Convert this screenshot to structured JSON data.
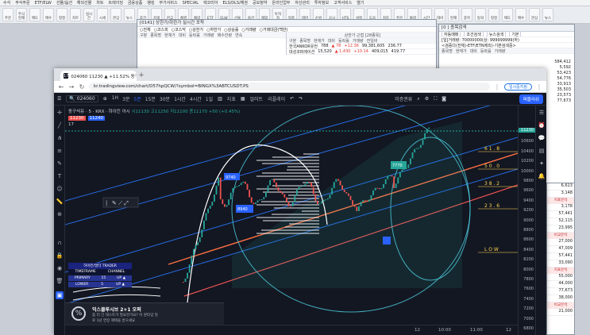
{
  "hts": {
    "menu": [
      "수식",
      "주식주문",
      "ETF/ELW",
      "선물/옵션",
      "해외선물",
      "차트",
      "트레이딩",
      "금융상품",
      "뱅킹",
      "부가서비스",
      "SPECIAL",
      "렉코리아",
      "ELS/DLS/채권",
      "공모청약",
      "온라인업무",
      "자산관리",
      "투자정보",
      "고객서비스",
      "열기"
    ],
    "toolbar": [
      "주문",
      "주식현재",
      "매도",
      "매수",
      "정정",
      "차트",
      "실시간",
      "시세",
      "관심",
      "뉴스",
      "조건",
      "검색",
      "잔고",
      "체결",
      "예약",
      "ETF",
      "ELW",
      "선물",
      "옵션",
      "해외",
      "투자자",
      "업종",
      "테마",
      "순위",
      "공시",
      "HTS",
      "설정",
      "도움",
      "차트",
      "주문",
      "통합",
      "시간",
      "대비",
      "현재",
      "종목",
      "등락",
      "정정",
      "매도",
      "매수",
      "관심",
      "뉴스"
    ],
    "mid_window": {
      "title": "[0141] 상한가/하한가 실시간 포착",
      "radios": [
        "전체",
        "코스피",
        "코스닥",
        "상한가",
        "하한가",
        "상승률",
        "거래량",
        "거래대금(백만)"
      ],
      "cols_left": [
        "구분",
        "종목명",
        "현재가",
        "대비",
        "등락률",
        "거래량",
        "매수잔량",
        "연속"
      ],
      "right_title": "상한가 근접 [28종목]",
      "cols_right": [
        "구분",
        "종목명",
        "현재가",
        "대비",
        "등락률",
        "거래량",
        "전일비"
      ],
      "rows": [
        {
          "name": "한국ANKOR유전",
          "price": "788",
          "diff": "▲ 78",
          "rate": "+12.36",
          "vol": "99,381,605",
          "prev": "236.77"
        },
        {
          "name": "대성코퍼레이션",
          "price": "15,520",
          "diff": "▲ 1,430",
          "rate": "+10.14",
          "vol": "409,015",
          "prev": "419.77"
        }
      ]
    },
    "right_window": {
      "title": "[0 ] 종목검색",
      "tabs": [
        "자동매매",
        "조건검색",
        "뉴스검색",
        "기본"
      ],
      "filter": "[일]거래량: 70000000(상: 999999999(하)",
      "filter2": "<검증다(전체)-ETF/ETN제외)-기본검색중>",
      "cols": [
        "종목명",
        "현재가",
        "대비",
        "등락률",
        "거래량"
      ],
      "volumes": [
        "584,412",
        "5,592",
        "53,423",
        "54,776",
        "33,913",
        "35,503",
        "23,573",
        "77,673"
      ],
      "side_rows": [
        "6,613",
        "3,148",
        "3,178",
        "57,441",
        "52,115",
        "23,995",
        "27,000",
        "47,009",
        "57,441",
        "33,090",
        "55,000",
        "44,000",
        "77,673",
        "38,000",
        "21,000"
      ],
      "side_labels": [
        "지표분석",
        "비교분석",
        "지표분석",
        "비교분석"
      ]
    }
  },
  "browser": {
    "tab_title": "024060 11230 ▲ +11.52% 동구석유 - 5",
    "url": "kr.tradingview.com/chart/D57hpQCW/?symbol=BINGX%3ABTCUSDT.PS",
    "pause": "일시중지됨"
  },
  "tv": {
    "symbol": "024060",
    "search_code": "024060",
    "intervals": [
      "1H",
      "3분",
      "5분",
      "15분",
      "30분",
      "1시간",
      "4시간",
      "1일"
    ],
    "active_interval": "5분",
    "toolbar": [
      "지표",
      "얼러트",
      "리플레이"
    ],
    "layout": "미증권류",
    "publish": "퍼블리쉬",
    "legend": {
      "title": "동구석유 · 5 · KRX · 하이킨 아시",
      "ohlc": "시11130 고11250 저11100 종11170 +50 (+0.45%)",
      "val1": "11230",
      "val2": "11240",
      "count": "17"
    },
    "price_labels": [
      "10800",
      "10600",
      "10400",
      "10200",
      "10000",
      "9800",
      "9600",
      "9400",
      "9200",
      "9000",
      "8800",
      "8600",
      "8400",
      "8200",
      "8000",
      "7800",
      "7600",
      "7400",
      "7200",
      "7000",
      "6800"
    ],
    "last_price": "11230",
    "time_labels": [
      "12",
      "10:00",
      "11:00",
      "12"
    ],
    "fib_labels": [
      "6 1 . 8",
      "5 0 . 0",
      "3 8 . 2",
      "2 3 . 6",
      "L O W"
    ],
    "annotations": {
      "top_box": "7770",
      "mid_box": "8940",
      "left_box": "9740"
    },
    "indicator_table": {
      "header": "하이킨/멀티 TRADER",
      "cols": [
        "TIMEFRAME",
        "CHANNEL"
      ],
      "rows": [
        [
          "PRIMARY",
          "15",
          "UP ▲"
        ],
        [
          "LOWER",
          "5",
          "UP ▲"
        ]
      ]
    },
    "ad": {
      "title": "익스클루시브 2+1 오퍼",
      "line1": "좀 더 긴 테스트가 필요한가요? 이 원타임 딜",
      "line2": "로 1년 연장 혜택을 받으세요"
    }
  },
  "colors": {
    "bg": "#131722",
    "accent": "#2962ff",
    "green": "#26a69a",
    "red": "#ef5350",
    "channel": "#2979ff",
    "teal": "#4dd0e1",
    "orange": "#ff7043"
  }
}
